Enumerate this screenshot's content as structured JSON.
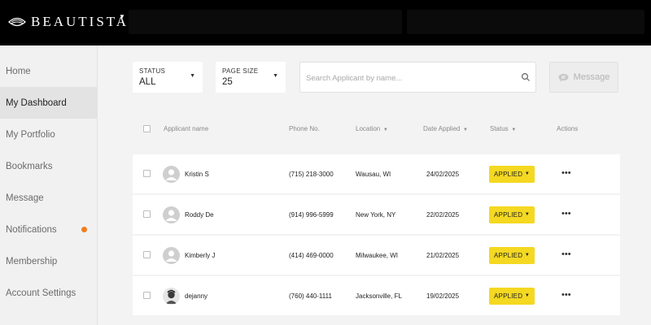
{
  "header": {
    "brand": "BEAUTISTA"
  },
  "sidebar": {
    "items": [
      {
        "label": "Home"
      },
      {
        "label": "My Dashboard"
      },
      {
        "label": "My Portfolio"
      },
      {
        "label": "Bookmarks"
      },
      {
        "label": "Message"
      },
      {
        "label": "Notifications"
      },
      {
        "label": "Membership"
      },
      {
        "label": "Account Settings"
      }
    ],
    "active": "My Dashboard",
    "notification_dot_color": "#f07d1f"
  },
  "filters": {
    "status": {
      "label": "STATUS",
      "value": "ALL"
    },
    "page_size": {
      "label": "PAGE SIZE",
      "value": "25"
    }
  },
  "search": {
    "placeholder": "Search Applicant by name...",
    "value": ""
  },
  "message_button": {
    "label": "Message"
  },
  "table": {
    "columns": {
      "name": "Applicant name",
      "phone": "Phone No.",
      "location": "Location",
      "date": "Date Applied",
      "status": "Status",
      "actions": "Actions"
    },
    "rows": [
      {
        "name": "Kristin S",
        "phone": "(715) 218-3000",
        "location": "Wausau, WI",
        "date": "24/02/2025",
        "status": "APPLIED",
        "actions": "•••"
      },
      {
        "name": "Roddy De",
        "phone": "(914) 996-5999",
        "location": "New York, NY",
        "date": "22/02/2025",
        "status": "APPLIED",
        "actions": "•••"
      },
      {
        "name": "Kimberly J",
        "phone": "(414) 469-0000",
        "location": "Milwaukee, WI",
        "date": "21/02/2025",
        "status": "APPLIED",
        "actions": "•••"
      },
      {
        "name": "dejanny",
        "phone": "(760) 440-1111",
        "location": "Jacksonville, FL",
        "date": "19/02/2025",
        "status": "APPLIED",
        "actions": "•••"
      }
    ]
  },
  "colors": {
    "topbar": "#000000",
    "status_badge": "#f4d821",
    "notification_dot": "#f07d1f"
  }
}
